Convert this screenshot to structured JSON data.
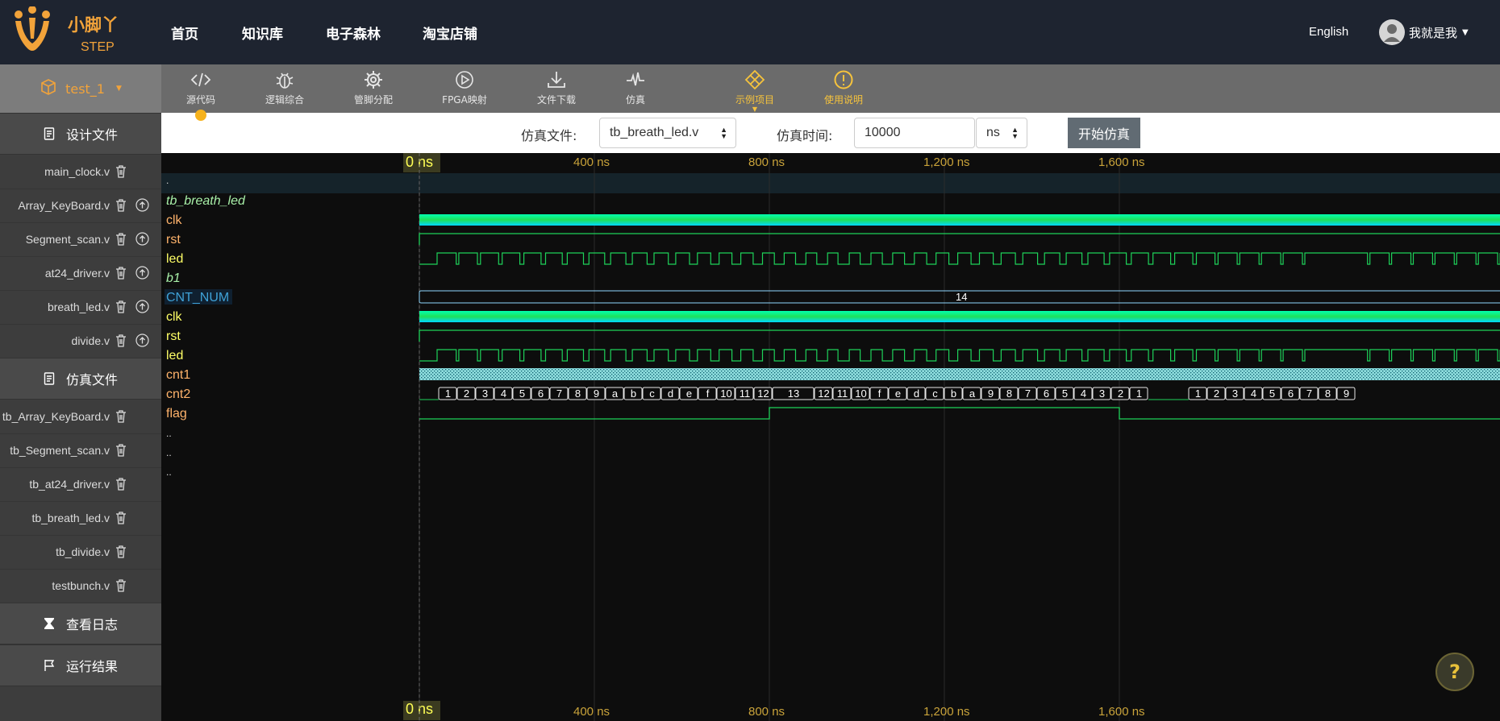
{
  "logo": {
    "name": "小脚丫",
    "sub": "STEP"
  },
  "nav": [
    "首页",
    "知识库",
    "电子森林",
    "淘宝店铺"
  ],
  "lang": "English",
  "user": {
    "name": "我就是我"
  },
  "project": {
    "name": "test_1"
  },
  "tools": [
    {
      "label": "源代码",
      "icon": "code-icon"
    },
    {
      "label": "逻辑综合",
      "icon": "bug-icon"
    },
    {
      "label": "管脚分配",
      "icon": "gear-icon"
    },
    {
      "label": "FPGA映射",
      "icon": "play-icon"
    },
    {
      "label": "文件下载",
      "icon": "download-icon"
    },
    {
      "label": "仿真",
      "icon": "pulse-icon"
    },
    {
      "label": "示例项目",
      "icon": "diamond-icon"
    },
    {
      "label": "使用说明",
      "icon": "alert-icon"
    }
  ],
  "sidebar": {
    "design_title": "设计文件",
    "design_files": [
      "main_clock.v",
      "Array_KeyBoard.v",
      "Segment_scan.v",
      "at24_driver.v",
      "breath_led.v",
      "divide.v"
    ],
    "sim_title": "仿真文件",
    "sim_files": [
      "tb_Array_KeyBoard.v",
      "tb_Segment_scan.v",
      "tb_at24_driver.v",
      "tb_breath_led.v",
      "tb_divide.v",
      "testbunch.v"
    ],
    "log": "查看日志",
    "result": "运行结果"
  },
  "simbar": {
    "file_label": "仿真文件:",
    "file_value": "tb_breath_led.v",
    "time_label": "仿真时间:",
    "time_value": "10000",
    "unit": "ns",
    "start": "开始仿真"
  },
  "wave": {
    "ticks": [
      "0 ns",
      "400 ns",
      "800 ns",
      "1,200 ns",
      "1,600 ns"
    ],
    "module": "tb_breath_led",
    "signals": [
      "clk",
      "rst",
      "led",
      "b1",
      "CNT_NUM",
      "clk",
      "rst",
      "led",
      "cnt1",
      "cnt2",
      "flag"
    ],
    "cnt_num_value": "14",
    "cnt2_values": [
      "1",
      "2",
      "3",
      "4",
      "5",
      "6",
      "7",
      "8",
      "9",
      "a",
      "b",
      "c",
      "d",
      "e",
      "f",
      "10",
      "11",
      "12",
      "13",
      "12",
      "11",
      "10",
      "f",
      "e",
      "d",
      "c",
      "b",
      "a",
      "9",
      "8",
      "7",
      "6",
      "5",
      "4",
      "3",
      "2",
      "1",
      "1",
      "2",
      "3",
      "4",
      "5",
      "6",
      "7",
      "8",
      "9"
    ]
  },
  "help": "?"
}
